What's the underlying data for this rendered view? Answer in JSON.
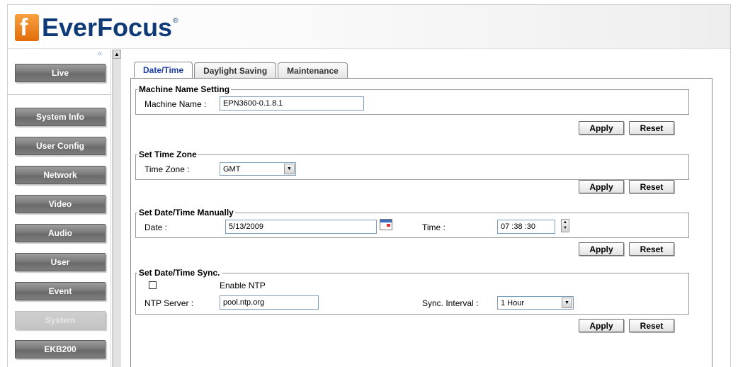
{
  "brand": {
    "logo_letter": "f",
    "name": "EverFocus",
    "registered": "®"
  },
  "sidebar": {
    "collapse": "«",
    "items": [
      {
        "label": "Live"
      },
      {
        "label": "System Info"
      },
      {
        "label": "User Config"
      },
      {
        "label": "Network"
      },
      {
        "label": "Video"
      },
      {
        "label": "Audio"
      },
      {
        "label": "User"
      },
      {
        "label": "Event"
      },
      {
        "label": "System",
        "active": true
      },
      {
        "label": "EKB200"
      }
    ]
  },
  "scrollbar": {
    "up": "▲"
  },
  "tabs": [
    {
      "label": "Date/Time",
      "active": true
    },
    {
      "label": "Daylight Saving"
    },
    {
      "label": "Maintenance"
    }
  ],
  "machine_name": {
    "legend": "Machine Name Setting",
    "label": "Machine Name :",
    "value": "EPN3600-0.1.8.1"
  },
  "time_zone": {
    "legend": "Set Time Zone",
    "label": "Time Zone :",
    "value": "GMT"
  },
  "manual": {
    "legend": "Set Date/Time Manually",
    "date_label": "Date :",
    "date_value": "5/13/2009",
    "time_label": "Time :",
    "time_value": "07 :38 :30"
  },
  "sync": {
    "legend": "Set Date/Time Sync.",
    "enable_label": "Enable NTP",
    "enable_checked": false,
    "server_label": "NTP Server :",
    "server_value": "pool.ntp.org",
    "interval_label": "Sync. Interval :",
    "interval_value": "1 Hour"
  },
  "buttons": {
    "apply": "Apply",
    "reset": "Reset"
  },
  "icons": {
    "dropdown": "▼",
    "spin_up": "▲",
    "spin_down": "▼"
  }
}
